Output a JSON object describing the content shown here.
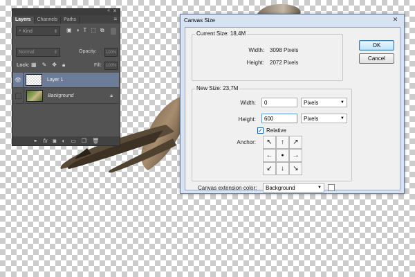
{
  "layers_panel": {
    "tabs": [
      "Layers",
      "Channels",
      "Paths"
    ],
    "active_tab": "Layers",
    "filter": {
      "kind_label": "Kind"
    },
    "blend_mode": "Normal",
    "opacity_label": "Opacity:",
    "opacity_value": "100%",
    "lock_label": "Lock:",
    "fill_label": "Fill:",
    "fill_value": "100%",
    "layers": [
      {
        "name": "Layer 1",
        "selected": true,
        "visible": true
      },
      {
        "name": "Background",
        "selected": false,
        "visible": false,
        "locked": true
      }
    ],
    "bottom_icons": [
      "link-icon",
      "fx-icon",
      "mask-icon",
      "adjustment-icon",
      "group-folder-icon",
      "new-layer-icon",
      "trash-icon"
    ]
  },
  "dialog": {
    "title": "Canvas Size",
    "current_size": {
      "legend": "Current Size: 18,4M",
      "width_label": "Width:",
      "width_value": "3098 Pixels",
      "height_label": "Height:",
      "height_value": "2072 Pixels"
    },
    "new_size": {
      "legend": "New Size: 23,7M",
      "width_label": "Width:",
      "width_value": "0",
      "width_unit": "Pixels",
      "height_label": "Height:",
      "height_value": "600",
      "height_unit": "Pixels",
      "relative_label": "Relative",
      "relative_checked": true,
      "anchor_label": "Anchor:",
      "anchor_glyphs": [
        "↖",
        "↑",
        "↗",
        "←",
        "●",
        "→",
        "↙",
        "↓",
        "↘"
      ]
    },
    "extension_color_label": "Canvas extension color:",
    "extension_color_value": "Background",
    "ok_label": "OK",
    "cancel_label": "Cancel"
  }
}
